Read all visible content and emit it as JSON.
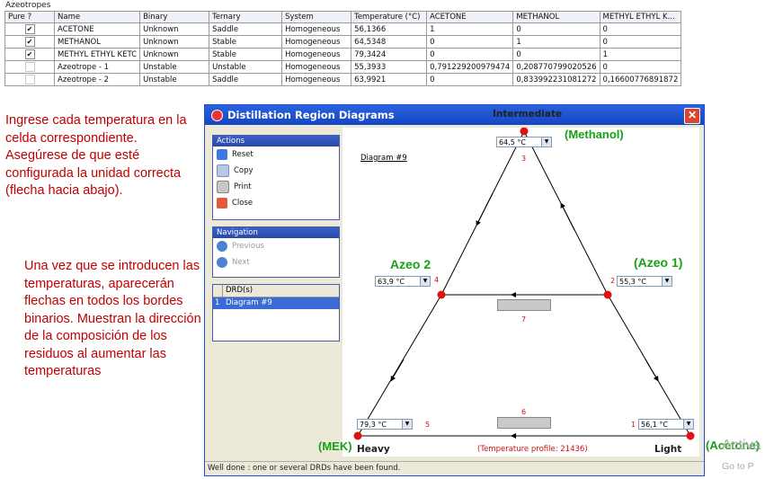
{
  "azeotropes": {
    "title": "Azeotropes",
    "headers": [
      "Pure ?",
      "Name",
      "Binary",
      "Ternary",
      "System",
      "Temperature (°C)",
      "ACETONE",
      "METHANOL",
      "METHYL ETHYL K..."
    ],
    "rows": [
      {
        "pure": true,
        "name": "ACETONE",
        "binary": "Unknown",
        "ternary": "Saddle",
        "system": "Homogeneous",
        "temperature": "56,1366",
        "acetone": "1",
        "methanol": "0",
        "mek": "0"
      },
      {
        "pure": true,
        "name": "METHANOL",
        "binary": "Unknown",
        "ternary": "Stable",
        "system": "Homogeneous",
        "temperature": "64,5348",
        "acetone": "0",
        "methanol": "1",
        "mek": "0"
      },
      {
        "pure": true,
        "name": "METHYL ETHYL KETC",
        "binary": "Unknown",
        "ternary": "Stable",
        "system": "Homogeneous",
        "temperature": "79,3424",
        "acetone": "0",
        "methanol": "0",
        "mek": "1"
      },
      {
        "pure": false,
        "name": "Azeotrope - 1",
        "binary": "Unstable",
        "ternary": "Unstable",
        "system": "Homogeneous",
        "temperature": "55,3933",
        "acetone": "0,791229200979474",
        "methanol": "0,208770799020526",
        "mek": "0"
      },
      {
        "pure": false,
        "name": "Azeotrope - 2",
        "binary": "Unstable",
        "ternary": "Saddle",
        "system": "Homogeneous",
        "temperature": "63,9921",
        "acetone": "0",
        "methanol": "0,833992231081272",
        "mek": "0,16600776891872"
      }
    ]
  },
  "annotations": {
    "note1": "Ingrese cada temperatura en la celda correspondiente. Asegúrese de que esté configurada la unidad correcta (flecha hacia abajo).",
    "note2": "Una vez que se introducen las temperaturas, aparecerán flechas en todos los bordes binarios. Muestran la dirección de la composición de los residuos al aumentar las temperaturas",
    "methanol": "(Methanol)",
    "azeo1": "(Azeo 1)",
    "azeo2": "Azeo 2",
    "mek": "(MEK)",
    "acetone": "(Acetone)"
  },
  "window": {
    "title": "Distillation Region Diagrams",
    "close_glyph": "✕",
    "actions_header": "Actions",
    "actions": [
      "Reset",
      "Copy",
      "Print",
      "Close"
    ],
    "navigation_header": "Navigation",
    "navigation": [
      "Previous",
      "Next"
    ],
    "drd_header": "DRD(s)",
    "drd_items": [
      {
        "index": "1",
        "label": "Diagram #9"
      }
    ],
    "status": "Well done : one or several DRDs have been found."
  },
  "diagram": {
    "name": "Diagram #9",
    "top_label": "Intermediate",
    "left_label": "Heavy",
    "right_label": "Light",
    "profile": "(Temperature profile: 21436)",
    "temps": {
      "top": "64,5 °C",
      "azeo1": "55,3 °C",
      "azeo2": "63,9 °C",
      "heavy": "79,3 °C",
      "light": "56,1 °C"
    },
    "node_numbers": {
      "light": "1",
      "azeo1": "2",
      "top": "3",
      "azeo2": "4",
      "heavy": "5",
      "bottom_edge": "6",
      "middle_edge": "7"
    }
  },
  "watermark": {
    "line1": "Activa",
    "line2": "Go to P"
  },
  "colors": {
    "accent_red": "#c00000",
    "green": "#18a018",
    "titlebar": "#1546c4",
    "node": "#e01010"
  }
}
